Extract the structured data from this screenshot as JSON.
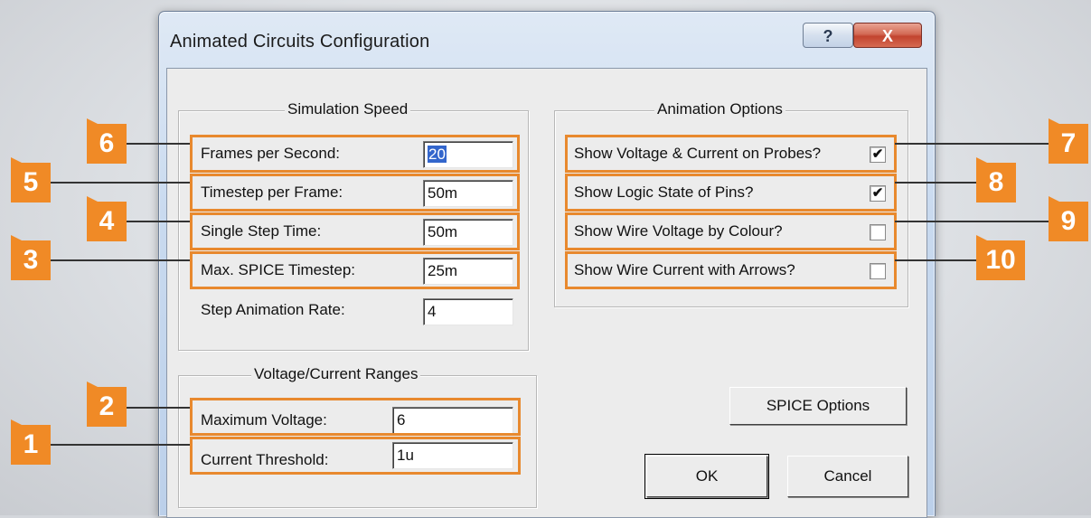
{
  "window": {
    "title": "Animated Circuits Configuration",
    "help_label": "?",
    "close_label": "X"
  },
  "simulation_speed": {
    "title": "Simulation Speed",
    "fields": [
      {
        "label": "Frames per Second:",
        "value": "20",
        "selected": true
      },
      {
        "label": "Timestep per Frame:",
        "value": "50m"
      },
      {
        "label": "Single Step Time:",
        "value": "50m"
      },
      {
        "label": "Max. SPICE Timestep:",
        "value": "25m"
      },
      {
        "label": "Step Animation Rate:",
        "value": "4"
      }
    ]
  },
  "voltage_current": {
    "title": "Voltage/Current Ranges",
    "fields": [
      {
        "label": "Maximum Voltage:",
        "value": "6"
      },
      {
        "label": "Current Threshold:",
        "value": "1u"
      }
    ]
  },
  "animation_options": {
    "title": "Animation Options",
    "options": [
      {
        "label": "Show Voltage & Current on Probes?",
        "checked": true
      },
      {
        "label": "Show Logic State of Pins?",
        "checked": true
      },
      {
        "label": "Show Wire Voltage by Colour?",
        "checked": false
      },
      {
        "label": "Show Wire Current with Arrows?",
        "checked": false
      }
    ],
    "check_mark": "✔"
  },
  "buttons": {
    "spice_options": "SPICE Options",
    "ok": "OK",
    "cancel": "Cancel"
  },
  "callouts": [
    "1",
    "2",
    "3",
    "4",
    "5",
    "6",
    "7",
    "8",
    "9",
    "10"
  ],
  "colors": {
    "callout": "#f08a26",
    "highlight": "#e8892e",
    "selection": "#3366cc"
  }
}
